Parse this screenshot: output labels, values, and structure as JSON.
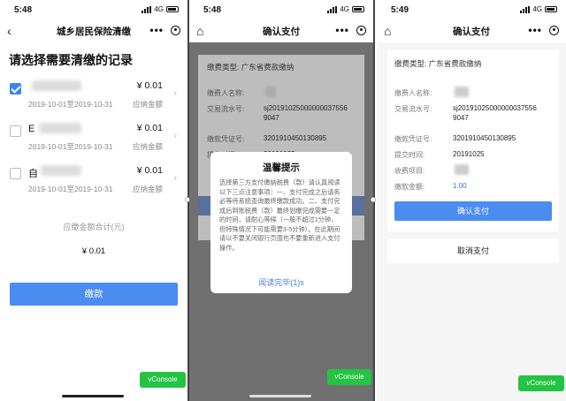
{
  "phone1": {
    "time": "5:48",
    "network": "4G",
    "title": "城乡居民保险清缴",
    "heading": "请选择需要清缴的记录",
    "records": [
      {
        "name": "",
        "date": "2019-10-01至2019-10-31",
        "amount": "¥ 0.01",
        "label": "应纳金额",
        "checked": true
      },
      {
        "name": "E",
        "date": "2019-10-01至2019-10-31",
        "amount": "¥ 0.01",
        "label": "应纳金额",
        "checked": false
      },
      {
        "name": "自",
        "date": "2019-10-01至2019-10-31",
        "amount": "¥ 0.01",
        "label": "应纳金额",
        "checked": false
      }
    ],
    "total_label": "应缴金额合计(元)",
    "total_value": "¥ 0.01",
    "pay_button": "缴款",
    "vconsole": "vConsole"
  },
  "phone2": {
    "time": "5:48",
    "network": "4G",
    "title": "确认支付",
    "card_title": "缴费类型: 广东省费款缴纳",
    "rows": [
      {
        "label": "缴费人名称:",
        "value": ""
      },
      {
        "label": "交易流水号:",
        "value": "sj20191025000000037556 9047"
      },
      {
        "label": "缴款凭证号:",
        "value": "3201910450130895"
      },
      {
        "label": "提交时间:",
        "value": "20191025"
      }
    ],
    "dialog": {
      "title": "温馨提示",
      "body": "选择第三方支付缴纳税费（款）请认真阅读以下三点注意事项：一、支付完成之后请务必等待系统查询最终缴款成功。二、支付完成后到账税费（款）最终划缴完成需要一定的时间，请耐心等候（一般不超过1分钟，但特殊情况下可能需要3-5分钟）。在此期间请以不要关闭银行页面也不要重新进入支付操作。",
      "button": "阅读完毕(1)s"
    },
    "vconsole": "vConsole"
  },
  "phone3": {
    "time": "5:49",
    "network": "4G",
    "title": "确认支付",
    "card_title": "缴费类型: 广东省费款缴纳",
    "rows": [
      {
        "label": "缴费人名称:",
        "value": ""
      },
      {
        "label": "交易流水号:",
        "value": "sj20191025000000037556 9047"
      },
      {
        "label": "缴款凭证号:",
        "value": "3201910450130895"
      },
      {
        "label": "提交时间:",
        "value": "20191025"
      },
      {
        "label": "收费项目:",
        "value": ""
      },
      {
        "label": "缴款金额:",
        "value": "1.00"
      }
    ],
    "confirm_button": "确认支付",
    "cancel_button": "取消支付",
    "vconsole": "vConsole"
  }
}
